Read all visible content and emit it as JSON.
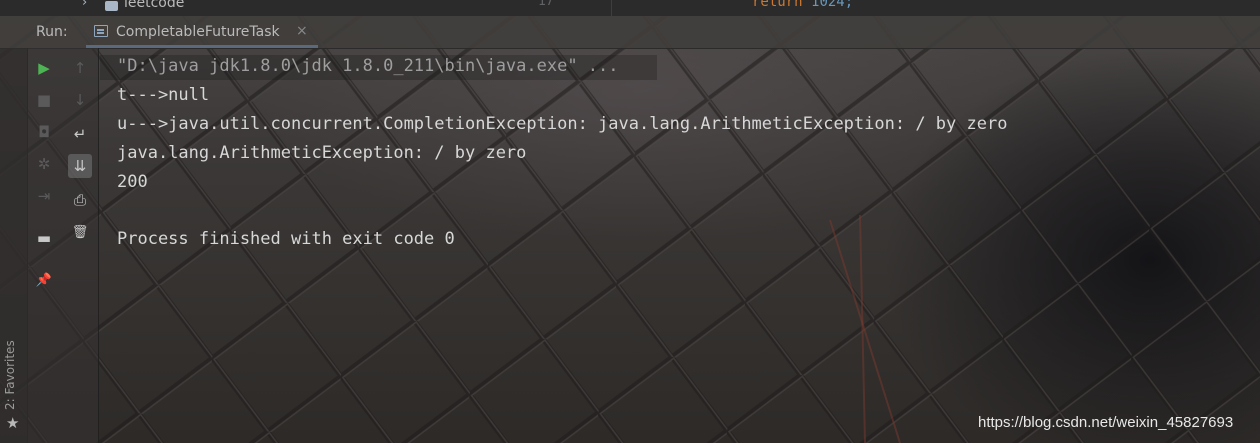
{
  "project_tree": {
    "folder_label": "leetcode"
  },
  "editor": {
    "line_number": "17",
    "code_keyword": "return",
    "code_value": "1024;"
  },
  "run_panel": {
    "label": "Run:",
    "tab": {
      "title": "CompletableFutureTask",
      "close_glyph": "×"
    }
  },
  "toolbar": {
    "column1": [
      {
        "icon": "rerun-icon",
        "glyph": "▶"
      },
      {
        "icon": "stop-icon",
        "glyph": "■"
      },
      {
        "icon": "camera-icon",
        "glyph": "◘"
      },
      {
        "icon": "gear-icon",
        "glyph": "✲"
      },
      {
        "icon": "exit-icon",
        "glyph": "⇥"
      },
      {
        "icon": "layout-icon",
        "glyph": "▬"
      },
      {
        "icon": "pin-icon",
        "glyph": "📌"
      }
    ],
    "column2": [
      {
        "icon": "arrow-up-icon",
        "glyph": "↑"
      },
      {
        "icon": "arrow-down-icon",
        "glyph": "↓"
      },
      {
        "icon": "soft-wrap-icon",
        "glyph": "↵"
      },
      {
        "icon": "scroll-to-end-icon",
        "glyph": "⇊"
      },
      {
        "icon": "print-icon",
        "glyph": "⎙"
      },
      {
        "icon": "trash-icon",
        "glyph": "🗑"
      }
    ]
  },
  "side_stripe": {
    "favorites_label": "2: Favorites",
    "favorites_star": "★"
  },
  "console": {
    "lines": [
      "\"D:\\java jdk1.8.0\\jdk 1.8.0_211\\bin\\java.exe\" ...",
      "t--->null",
      "u--->java.util.concurrent.CompletionException: java.lang.ArithmeticException: / by zero",
      "java.lang.ArithmeticException: / by zero",
      "200",
      "",
      "Process finished with exit code 0"
    ]
  },
  "watermark": "https://blog.csdn.net/weixin_45827693",
  "colors": {
    "keyword": "#cc7832",
    "number": "#6897bb",
    "run_green": "#4db453",
    "console_text": "#d7d7d7"
  }
}
